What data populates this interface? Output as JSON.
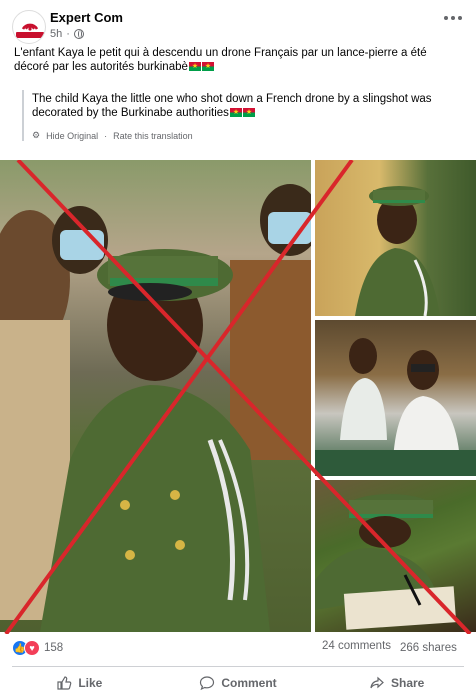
{
  "post": {
    "page_name": "Expert Com",
    "time": "5h",
    "text": "L'enfant Kaya le petit qui à descendu un drone Français par un lance-pierre a été décoré par les autorités burkinabè",
    "translation": "The child Kaya the little one who shot down a French drone by a slingshot was decorated by the Burkinabe authorities",
    "hide_original": "Hide Original",
    "rate_translation": "Rate this translation",
    "separator": "·"
  },
  "stats": {
    "reactions": "158",
    "comments": "24 comments",
    "shares": "266 shares"
  },
  "actions": {
    "like": "Like",
    "comment": "Comment",
    "share": "Share"
  },
  "colors": {
    "accent": "#1877f2",
    "cross": "#d9262b",
    "secondary_text": "#65676b"
  },
  "icons": [
    "globe-icon",
    "more-icon",
    "like-icon",
    "love-icon",
    "comment-icon",
    "share-icon",
    "gear-icon"
  ]
}
